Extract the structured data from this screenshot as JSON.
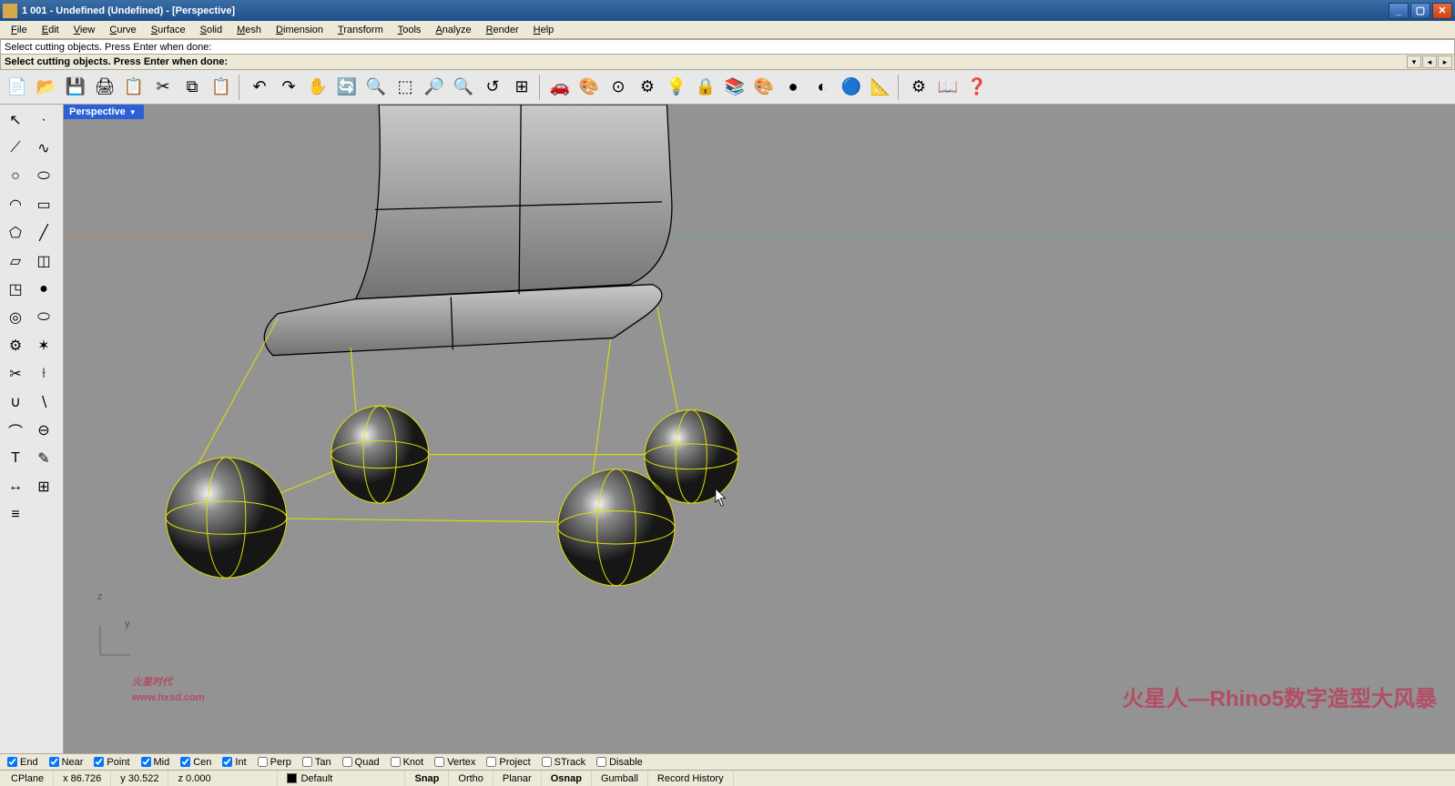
{
  "window": {
    "title": "1 001 - Undefined (Undefined) - [Perspective]"
  },
  "menubar": [
    "File",
    "Edit",
    "View",
    "Curve",
    "Surface",
    "Solid",
    "Mesh",
    "Dimension",
    "Transform",
    "Tools",
    "Analyze",
    "Render",
    "Help"
  ],
  "command": {
    "history": "Select cutting objects. Press Enter when done:",
    "prompt": "Select cutting objects. Press Enter when done:",
    "value": ""
  },
  "viewport": {
    "label": "Perspective"
  },
  "axis": {
    "z": "z",
    "y": "y"
  },
  "watermark": {
    "logo_main": "火星时代",
    "logo_url": "www.hxsd.com",
    "right": "火星人—Rhino5数字造型大风暴"
  },
  "osnap": {
    "items": [
      {
        "label": "End",
        "checked": true
      },
      {
        "label": "Near",
        "checked": true
      },
      {
        "label": "Point",
        "checked": true
      },
      {
        "label": "Mid",
        "checked": true
      },
      {
        "label": "Cen",
        "checked": true
      },
      {
        "label": "Int",
        "checked": true
      },
      {
        "label": "Perp",
        "checked": false
      },
      {
        "label": "Tan",
        "checked": false
      },
      {
        "label": "Quad",
        "checked": false
      },
      {
        "label": "Knot",
        "checked": false
      },
      {
        "label": "Vertex",
        "checked": false
      },
      {
        "label": "Project",
        "checked": false
      },
      {
        "label": "STrack",
        "checked": false
      },
      {
        "label": "Disable",
        "checked": false
      }
    ]
  },
  "status": {
    "cplane": "CPlane",
    "x": "x 86.726",
    "y": "y 30.522",
    "z": "z 0.000",
    "layer": "Default",
    "snap": "Snap",
    "ortho": "Ortho",
    "planar": "Planar",
    "osnap": "Osnap",
    "gumball": "Gumball",
    "record": "Record History"
  },
  "main_toolbar_icons": [
    "new",
    "open",
    "save",
    "print",
    "copy-clip",
    "cut",
    "copy",
    "paste",
    "undo",
    "redo",
    "pan",
    "rotate-view",
    "zoom",
    "zoom-window",
    "zoom-extents",
    "zoom-sel",
    "undo-view",
    "four-view",
    "car",
    "render",
    "camera",
    "options",
    "light",
    "lock",
    "layers",
    "color-wheel",
    "shade-gray",
    "shade-ghost",
    "shade-render",
    "properties",
    "gear",
    "help",
    "question"
  ],
  "side_toolbar_icons": [
    "pointer",
    "point",
    "polyline",
    "curve",
    "circle",
    "ellipse",
    "arc",
    "rectangle",
    "polygon",
    "line",
    "plane",
    "extrude",
    "box",
    "sphere",
    "torus",
    "pipe",
    "gear",
    "explode",
    "trim",
    "split",
    "boolean-union",
    "boolean-diff",
    "fillet",
    "difference",
    "text",
    "annotate",
    "dimension",
    "grid",
    "layers"
  ]
}
